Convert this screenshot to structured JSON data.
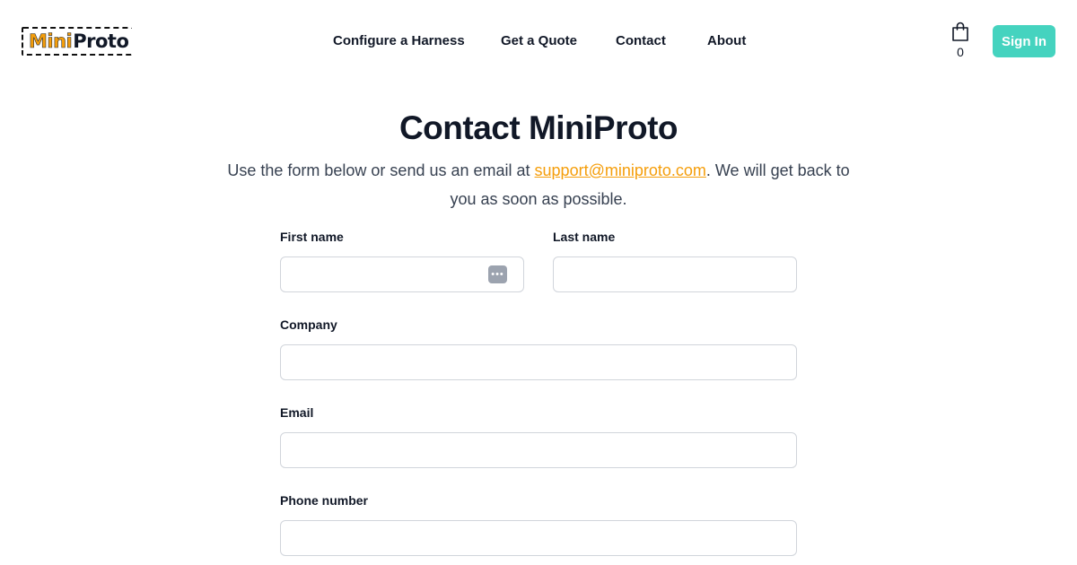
{
  "logo": {
    "part1": "Mini",
    "part2": "Proto"
  },
  "nav": {
    "items": [
      "Configure a Harness",
      "Get a Quote",
      "Contact",
      "About"
    ]
  },
  "cart": {
    "count": "0",
    "icon": "shopping-bag-icon"
  },
  "auth": {
    "signin_label": "Sign In"
  },
  "colors": {
    "accent": "#45d3bf",
    "link": "#f59e0b",
    "text": "#111827"
  },
  "page": {
    "title": "Contact MiniProto",
    "intro_before": "Use the form below or send us an email at ",
    "email": "support@miniproto.com",
    "intro_after": ". We will get back to you as soon as possible."
  },
  "form": {
    "first_name": {
      "label": "First name",
      "value": ""
    },
    "last_name": {
      "label": "Last name",
      "value": ""
    },
    "company": {
      "label": "Company",
      "value": ""
    },
    "email": {
      "label": "Email",
      "value": ""
    },
    "phone": {
      "label": "Phone number",
      "value": ""
    }
  }
}
